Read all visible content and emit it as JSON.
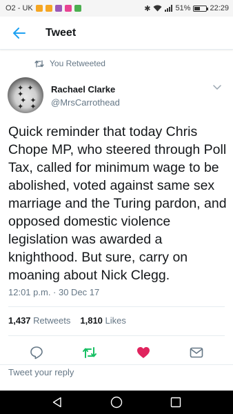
{
  "status_bar": {
    "carrier": "O2 - UK",
    "battery": "51%",
    "battery_level": 0.51,
    "time": "22:29",
    "app_colors": [
      "#f5a623",
      "#f5a623",
      "#9b59b6",
      "#e84393",
      "#4caf50"
    ]
  },
  "app_bar": {
    "title": "Tweet",
    "back_icon": "arrow-left-icon"
  },
  "retweet_context": {
    "label": "You Retweeted",
    "icon": "retweet-icon"
  },
  "tweet": {
    "author_name": "Rachael Clarke",
    "author_handle": "@MrsCarrothead",
    "text": "Quick reminder that today Chris Chope MP, who steered through Poll Tax, called for minimum wage to be abolished, voted against same sex marriage and the Turing pardon, and opposed domestic violence legislation was awarded a knighthood. But sure, carry on moaning about Nick Clegg.",
    "timestamp": "12:01 p.m. · 30 Dec 17",
    "retweets_count": "1,437",
    "retweets_label": "Retweets",
    "likes_count": "1,810",
    "likes_label": "Likes"
  },
  "actions": {
    "reply_icon": "reply-icon",
    "retweet_icon": "retweet-icon",
    "like_icon": "heart-icon",
    "dm_icon": "envelope-icon",
    "retweet_color": "#17bf63",
    "like_color": "#e0245e"
  },
  "reply_box": {
    "placeholder": "Tweet your reply"
  },
  "theme": {
    "accent": "#1da1f2",
    "muted": "#657786"
  }
}
